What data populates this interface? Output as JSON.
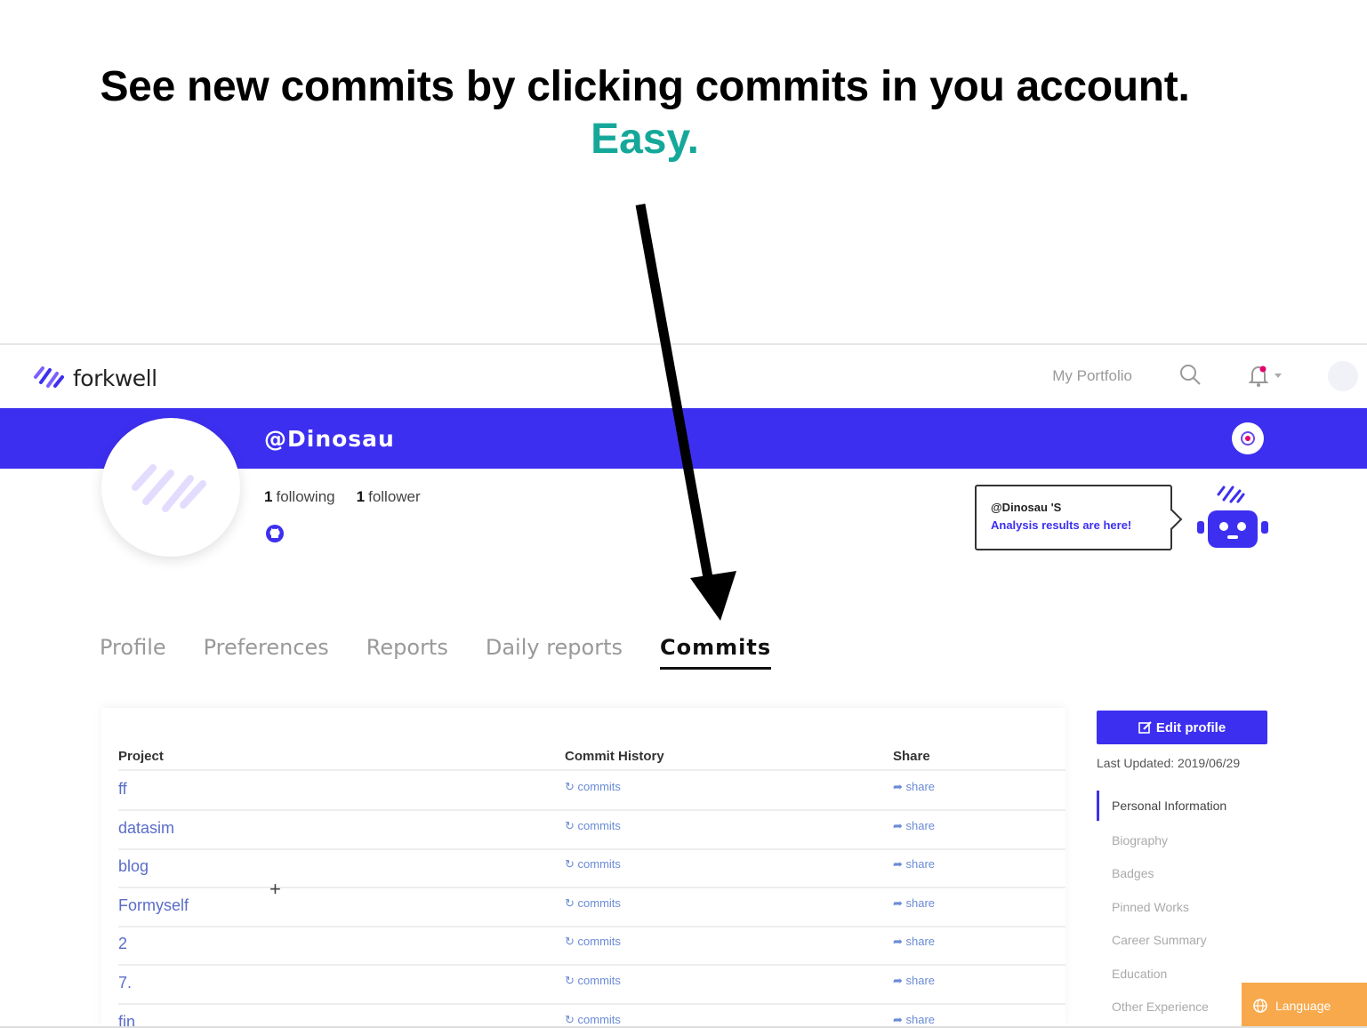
{
  "caption": {
    "line1": "See new commits by clicking commits in you account.",
    "line2": "Easy.",
    "accent_color": "#15a89a"
  },
  "header": {
    "logo_text": "forkwell",
    "my_portfolio": "My Portfolio",
    "icons": [
      "search-icon",
      "bell-icon",
      "avatar"
    ]
  },
  "banner": {
    "username": "@Dinosau",
    "color": "#3d2ff0"
  },
  "profile": {
    "following_count": "1",
    "following_label": "following",
    "follower_count": "1",
    "follower_label": "follower"
  },
  "analysis": {
    "user": "@Dinosau 'S",
    "message": "Analysis results are here!"
  },
  "tabs": [
    {
      "label": "Profile",
      "active": false
    },
    {
      "label": "Preferences",
      "active": false
    },
    {
      "label": "Reports",
      "active": false
    },
    {
      "label": "Daily reports",
      "active": false
    },
    {
      "label": "Commits",
      "active": true
    }
  ],
  "table": {
    "headers": {
      "project": "Project",
      "commit_history": "Commit History",
      "share": "Share"
    },
    "commit_label": "commits",
    "share_label": "share",
    "rows": [
      {
        "project": "ff"
      },
      {
        "project": "datasim"
      },
      {
        "project": "blog"
      },
      {
        "project": "Formyself"
      },
      {
        "project": "2"
      },
      {
        "project": "7."
      },
      {
        "project": "fin"
      }
    ]
  },
  "sidebar": {
    "edit_profile": "Edit profile",
    "last_updated": "Last Updated: 2019/06/29",
    "items": [
      {
        "label": "Personal Information",
        "active": true
      },
      {
        "label": "Biography",
        "active": false
      },
      {
        "label": "Badges",
        "active": false
      },
      {
        "label": "Pinned Works",
        "active": false
      },
      {
        "label": "Career Summary",
        "active": false
      },
      {
        "label": "Education",
        "active": false
      },
      {
        "label": "Other Experience",
        "active": false
      }
    ]
  },
  "language_button": "Language"
}
